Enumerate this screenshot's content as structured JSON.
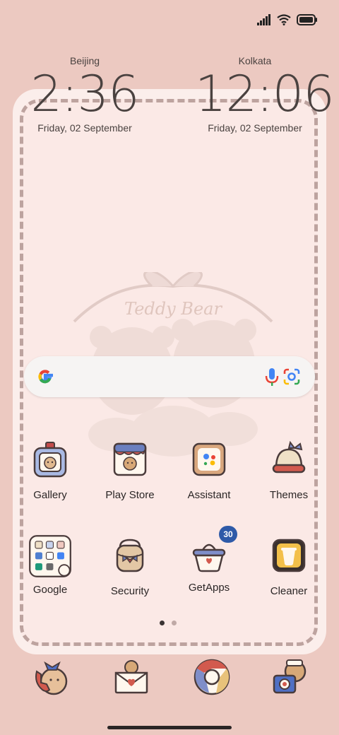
{
  "status_bar": {
    "icons": [
      "signal-icon",
      "wifi-icon",
      "battery-icon"
    ]
  },
  "clocks": [
    {
      "city": "Beijing",
      "time": "2:36",
      "date": "Friday, 02 September"
    },
    {
      "city": "Kolkata",
      "time": "12:06",
      "date": "Friday, 02 September"
    }
  ],
  "wallpaper": {
    "title": "Teddy Bear"
  },
  "search": {
    "icons": [
      "google-logo-icon",
      "microphone-icon",
      "google-lens-icon"
    ]
  },
  "apps": {
    "row1": [
      {
        "label": "Gallery",
        "icon": "gallery-icon"
      },
      {
        "label": "Play Store",
        "icon": "play-store-icon"
      },
      {
        "label": "Assistant",
        "icon": "assistant-icon"
      },
      {
        "label": "Themes",
        "icon": "themes-icon"
      }
    ],
    "row2": [
      {
        "label": "Google",
        "icon": "google-folder-icon"
      },
      {
        "label": "Security",
        "icon": "security-icon"
      },
      {
        "label": "GetApps",
        "icon": "getapps-icon",
        "badge": "30"
      },
      {
        "label": "Cleaner",
        "icon": "cleaner-icon"
      }
    ]
  },
  "page_indicator": {
    "total": 2,
    "current": 1
  },
  "dock": [
    {
      "icon": "phone-icon"
    },
    {
      "icon": "messages-icon"
    },
    {
      "icon": "chrome-icon"
    },
    {
      "icon": "camera-icon"
    }
  ],
  "colors": {
    "background": "#ecc9c1",
    "frame": "#fbeeeb",
    "text": "#2b2626",
    "badge": "#2e5aa8"
  }
}
